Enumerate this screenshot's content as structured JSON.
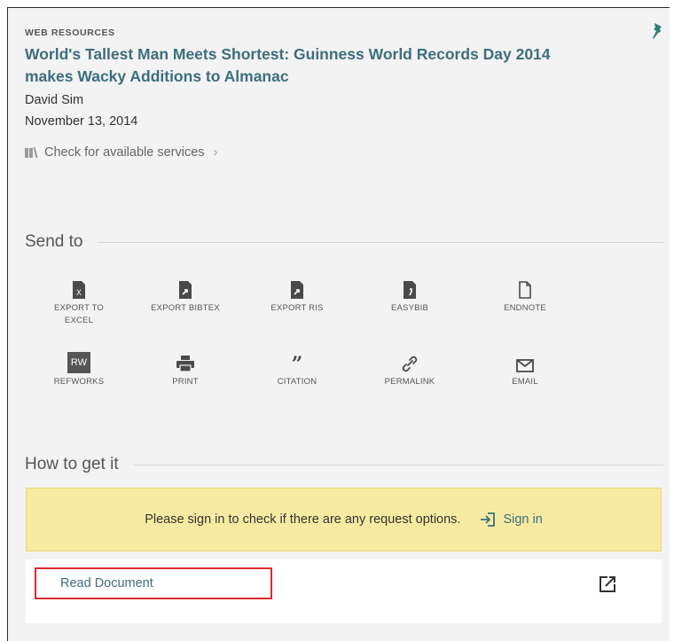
{
  "record": {
    "type_label": "WEB RESOURCES",
    "title": "World's Tallest Man Meets Shortest: Guinness World Records Day 2014 makes Wacky Additions to Almanac",
    "author": "David Sim",
    "date": "November 13, 2014",
    "check_services": "Check for available services"
  },
  "send_to": {
    "heading": "Send to",
    "actions": [
      {
        "label": "EXPORT TO EXCEL",
        "icon": "excel-file-icon"
      },
      {
        "label": "EXPORT BIBTEX",
        "icon": "bibtex-file-icon"
      },
      {
        "label": "EXPORT RIS",
        "icon": "ris-file-icon"
      },
      {
        "label": "EASYBIB",
        "icon": "easybib-file-icon"
      },
      {
        "label": "ENDNOTE",
        "icon": "endnote-file-icon"
      },
      {
        "label": "REFWORKS",
        "icon": "refworks-icon",
        "icon_text": "RW"
      },
      {
        "label": "PRINT",
        "icon": "printer-icon"
      },
      {
        "label": "CITATION",
        "icon": "quote-icon"
      },
      {
        "label": "PERMALINK",
        "icon": "link-icon"
      },
      {
        "label": "EMAIL",
        "icon": "envelope-icon"
      }
    ]
  },
  "how_to_get": {
    "heading": "How to get it",
    "notice": "Please sign in to check if there are any request options.",
    "sign_in": "Sign in",
    "link": "Read Document"
  },
  "colors": {
    "link": "#3d6e80",
    "pin": "#2e7d7a",
    "notice_bg": "#f7eba2",
    "highlight": "#e0282e"
  }
}
